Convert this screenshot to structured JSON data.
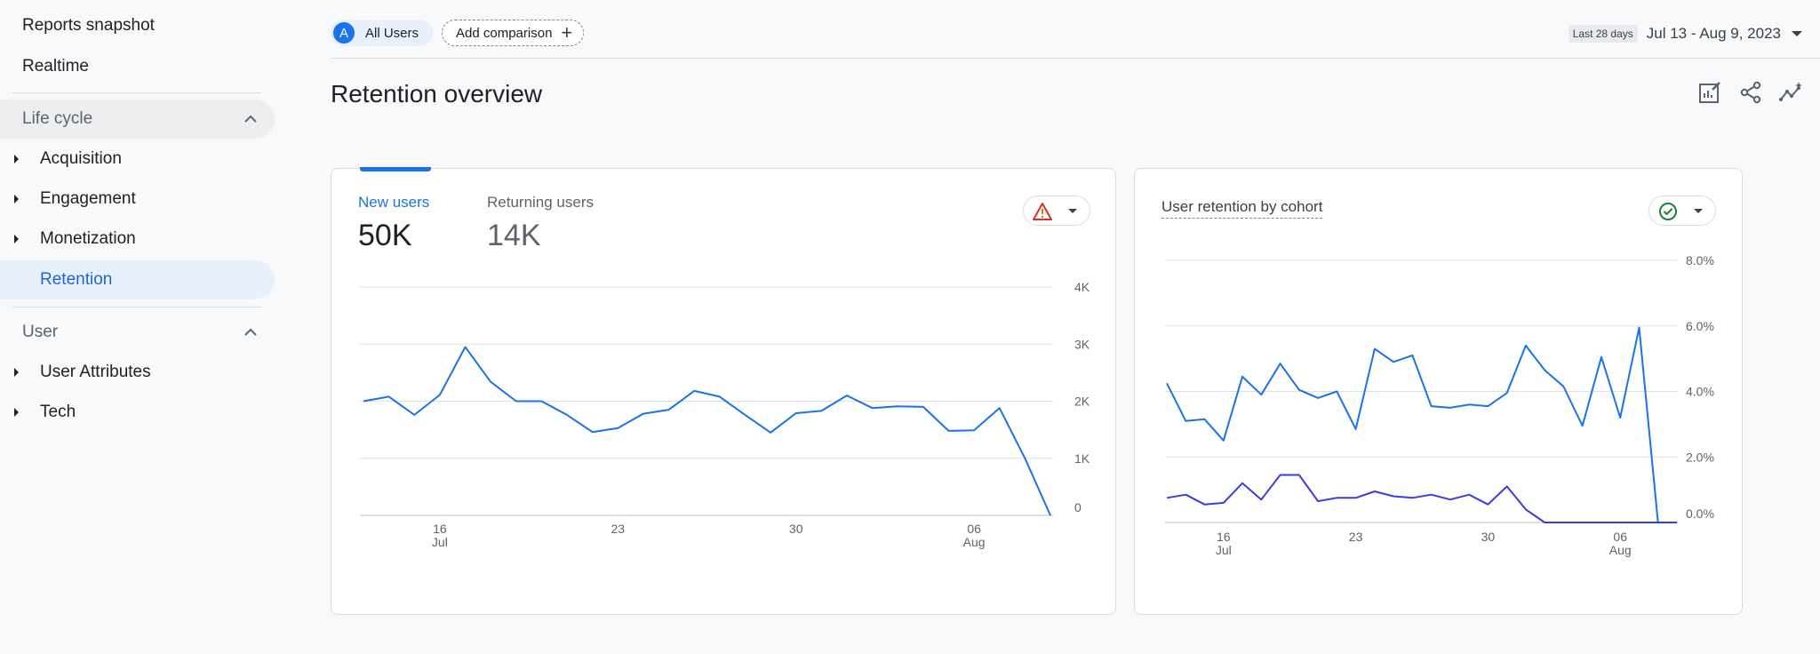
{
  "sidebar": {
    "top_items": [
      "Reports snapshot",
      "Realtime"
    ],
    "lifecycle": {
      "label": "Life cycle",
      "items": [
        {
          "label": "Acquisition",
          "expandable": true
        },
        {
          "label": "Engagement",
          "expandable": true
        },
        {
          "label": "Monetization",
          "expandable": true
        },
        {
          "label": "Retention",
          "expandable": false,
          "active": true
        }
      ]
    },
    "user": {
      "label": "User",
      "items": [
        {
          "label": "User Attributes",
          "expandable": true
        },
        {
          "label": "Tech",
          "expandable": true
        }
      ]
    }
  },
  "topbar": {
    "segment_avatar": "A",
    "segment_label": "All Users",
    "add_comparison": "Add comparison",
    "range_badge": "Last 28 days",
    "range_dates": "Jul 13 - Aug 9, 2023"
  },
  "page": {
    "title": "Retention overview"
  },
  "icons": {
    "customize": "edit-report-icon",
    "share": "share-icon",
    "insights": "insights-icon",
    "warning": "warning-icon",
    "check": "check-circle-icon"
  },
  "colors": {
    "accent": "#1a73e8",
    "series2": "#3d3ae0",
    "warning": "#d93025",
    "ok": "#188038"
  },
  "card1": {
    "tab1_label": "New users",
    "tab1_value": "50K",
    "tab2_label": "Returning users",
    "tab2_value": "14K"
  },
  "card2": {
    "title": "User retention by cohort"
  },
  "chart_data": [
    {
      "type": "line",
      "x_ticks": [
        {
          "label": "16",
          "sub": "Jul",
          "index": 3
        },
        {
          "label": "23",
          "sub": "",
          "index": 10
        },
        {
          "label": "30",
          "sub": "",
          "index": 17
        },
        {
          "label": "06",
          "sub": "Aug",
          "index": 24
        }
      ],
      "y_ticks": [
        "0",
        "1K",
        "2K",
        "3K",
        "4K"
      ],
      "ylim": [
        0,
        4000
      ],
      "series": [
        {
          "values": [
            2000,
            2080,
            1760,
            2110,
            2950,
            2340,
            2000,
            2000,
            1760,
            1460,
            1530,
            1780,
            1850,
            2180,
            2080,
            1760,
            1450,
            1790,
            1830,
            2100,
            1880,
            1910,
            1900,
            1480,
            1490,
            1880,
            1000,
            0
          ]
        }
      ]
    },
    {
      "type": "line",
      "x_ticks": [
        {
          "label": "16",
          "sub": "Jul",
          "index": 3
        },
        {
          "label": "23",
          "sub": "",
          "index": 10
        },
        {
          "label": "30",
          "sub": "",
          "index": 17
        },
        {
          "label": "06",
          "sub": "Aug",
          "index": 24
        }
      ],
      "y_ticks": [
        "0.0%",
        "2.0%",
        "4.0%",
        "6.0%",
        "8.0%"
      ],
      "ylim": [
        0,
        8
      ],
      "series": [
        {
          "values": [
            4.25,
            3.1,
            3.15,
            2.5,
            4.45,
            3.9,
            4.85,
            4.05,
            3.8,
            4.0,
            2.85,
            5.3,
            4.9,
            5.1,
            3.55,
            3.5,
            3.6,
            3.55,
            3.95,
            5.4,
            4.65,
            4.15,
            2.95,
            5.05,
            3.2,
            5.95,
            0.0,
            0.0
          ]
        },
        {
          "values": [
            0.75,
            0.85,
            0.55,
            0.6,
            1.2,
            0.7,
            1.45,
            1.45,
            0.65,
            0.75,
            0.75,
            0.95,
            0.8,
            0.75,
            0.85,
            0.7,
            0.85,
            0.55,
            1.1,
            0.4,
            0.0,
            0.0,
            0.0,
            0.0,
            0.0,
            0.0,
            0.0,
            0.0
          ]
        }
      ]
    }
  ]
}
